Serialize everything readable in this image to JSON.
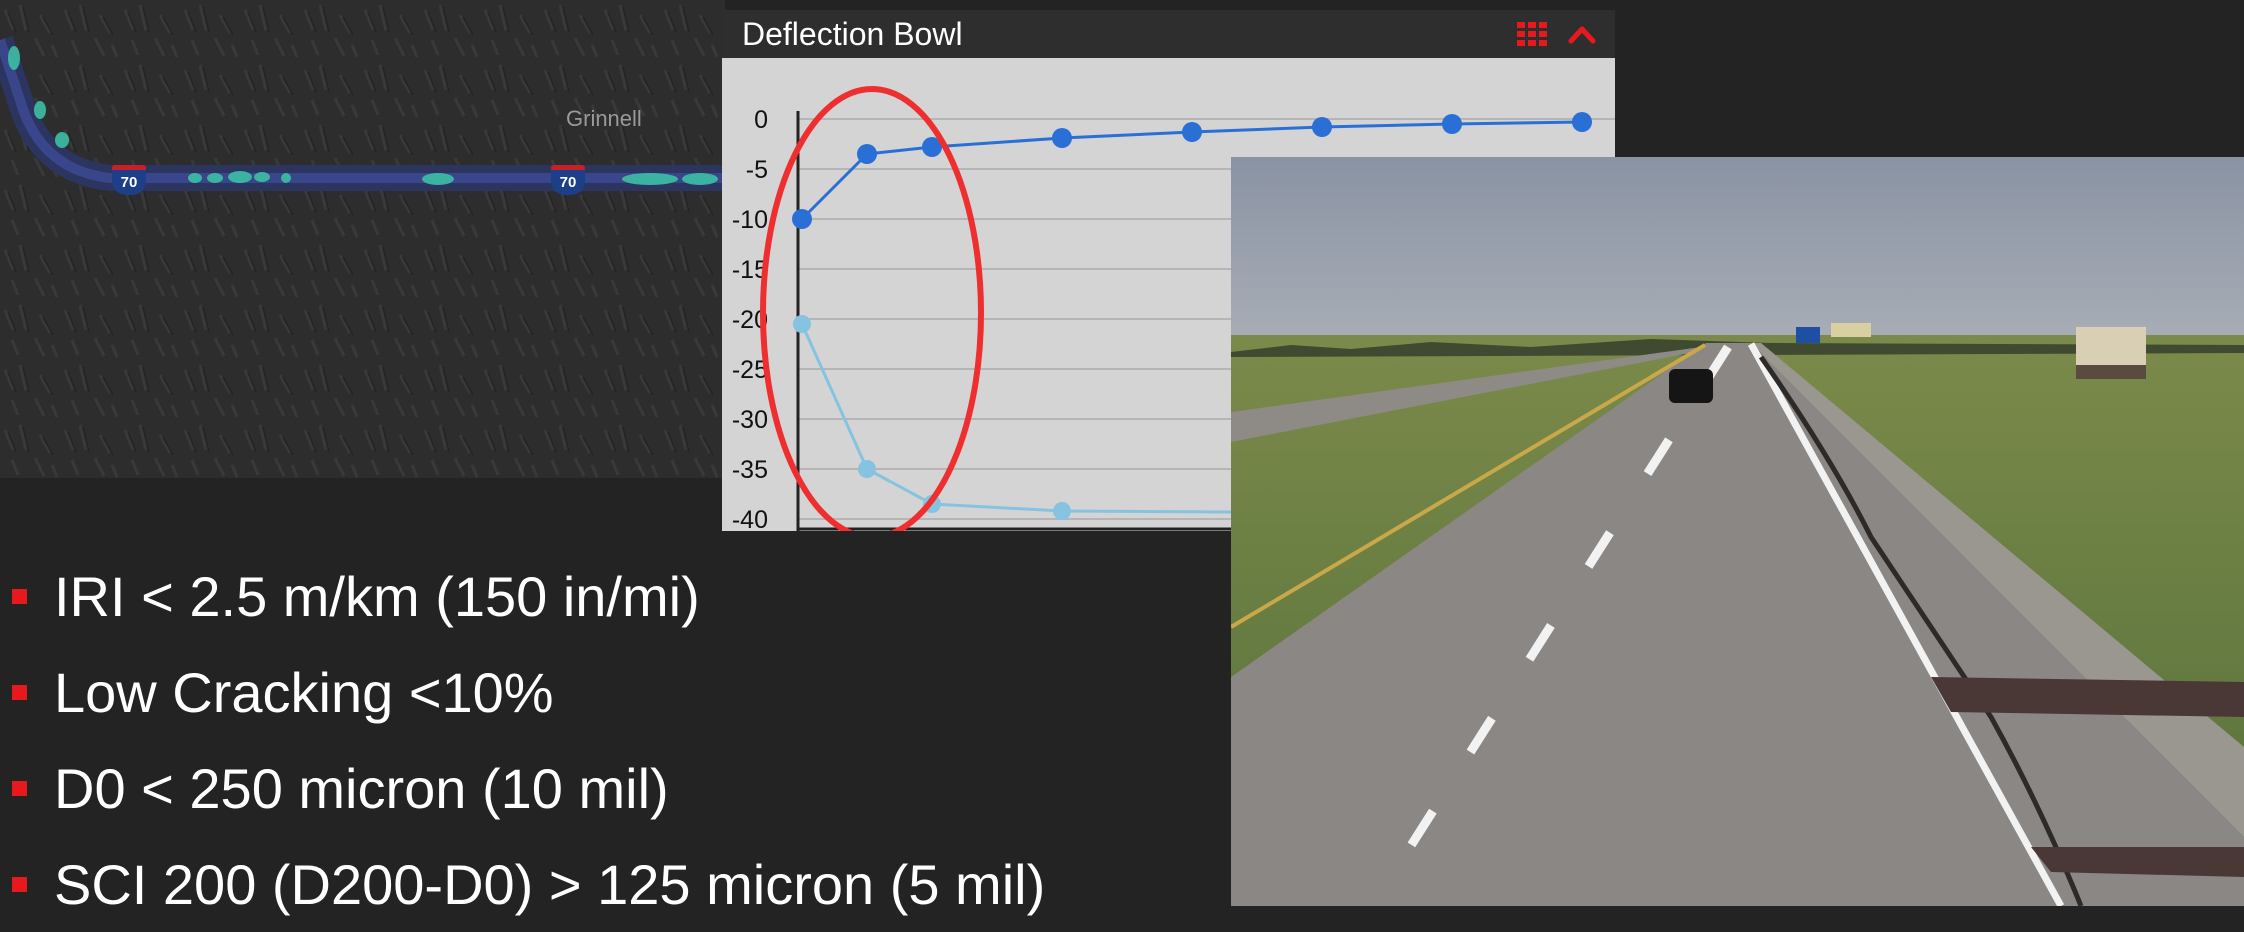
{
  "map": {
    "place_label": "Grinnell",
    "shield_label": "70"
  },
  "panel": {
    "title": "Deflection Bowl",
    "grid_icon": "grid-icon",
    "collapse_icon": "chevron-up-icon",
    "accent_color": "#e8191c"
  },
  "chart_data": {
    "type": "line",
    "title": "",
    "xlabel": "",
    "ylabel": "",
    "ylim": [
      -40,
      0
    ],
    "yticks": [
      "0",
      "-5",
      "-10",
      "-15",
      "-20",
      "-25",
      "-30",
      "-35",
      "-40"
    ],
    "series": [
      {
        "color": "#2a6fd6",
        "x": [
          0,
          1,
          2,
          4,
          6,
          8,
          10,
          12
        ],
        "values": [
          -10,
          -3.5,
          -2.8,
          -1.9,
          -1.3,
          -0.8,
          -0.5,
          -0.3
        ]
      },
      {
        "color": "#86c3e0",
        "x": [
          0,
          1,
          2,
          4,
          12
        ],
        "values": [
          -20.5,
          -35,
          -38.5,
          -39.2,
          -39.5
        ]
      }
    ],
    "annotation": "red ellipse around first points"
  },
  "bullets": [
    "IRI < 2.5 m/km (150 in/mi)",
    "Low Cracking <10%",
    "D0 < 250  micron (10 mil)",
    "SCI 200 (D200-D0) > 125 micron (5 mil)"
  ]
}
